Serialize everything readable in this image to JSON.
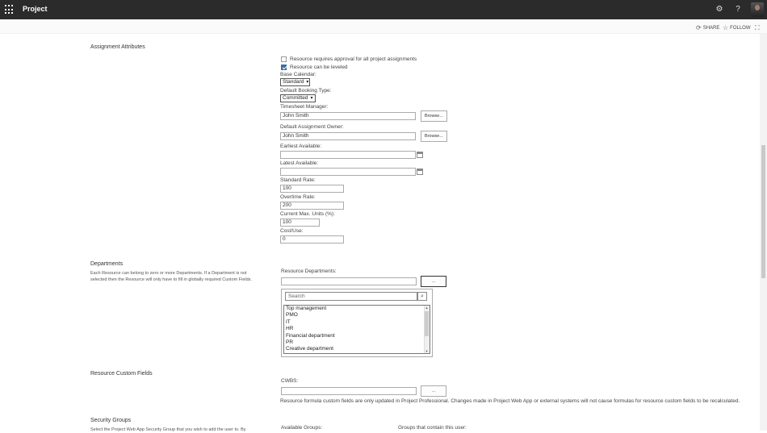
{
  "header": {
    "app_title": "Project",
    "icons": [
      "app-launcher-icon",
      "gear-icon",
      "help-icon",
      "avatar"
    ]
  },
  "subbar": {
    "share_label": "SHARE",
    "follow_label": "FOLLOW"
  },
  "assignment": {
    "section_title": "Assignment Attributes",
    "approval_label": "Resource requires approval for all project assignments",
    "approval_checked": false,
    "leveled_label": "Resource can be leveled",
    "leveled_checked": true,
    "base_calendar_label": "Base Calendar:",
    "base_calendar_value": "Standard",
    "booking_type_label": "Default Booking Type:",
    "booking_type_value": "Committed",
    "timesheet_manager_label": "Timesheet Manager:",
    "timesheet_manager_value": "John Smith",
    "browse_label": "Browse...",
    "assignment_owner_label": "Default Assignment Owner:",
    "assignment_owner_value": "John Smith",
    "earliest_available_label": "Earliest Available:",
    "latest_available_label": "Latest Available:",
    "standard_rate_label": "Standard Rate:",
    "standard_rate_value": "100",
    "overtime_rate_label": "Overtime Rate:",
    "overtime_rate_value": "200",
    "max_units_label": "Current Max. Units (%):",
    "max_units_value": "100",
    "cost_use_label": "Cost/Use:",
    "cost_use_value": "0"
  },
  "departments": {
    "section_title": "Departments",
    "description": "Each Resource can belong to zero or more Departments. If a Department is not selected then the Resource will only have to fill in globally required Custom Fields.",
    "field_label": "Resource Departments:",
    "picker_button": "...",
    "search_placeholder": "Search",
    "options": [
      "Top management",
      "PMO",
      "IT",
      "HR",
      "Financial department",
      "PR",
      "Creative department"
    ]
  },
  "custom_fields": {
    "section_title": "Resource Custom Fields",
    "cwbs_label": "CWBS:",
    "picker_button": "...",
    "note": "Resource formula custom fields are only updated in Project Professional. Changes made in Project Web App or external systems will not cause formulas for resource custom fields to be recalculated."
  },
  "security": {
    "section_title": "Security Groups",
    "description": "Select the Project Web App Security Group that you wish to add the user to. By",
    "available_label": "Available Groups:",
    "contains_label": "Groups that contain this user:"
  }
}
